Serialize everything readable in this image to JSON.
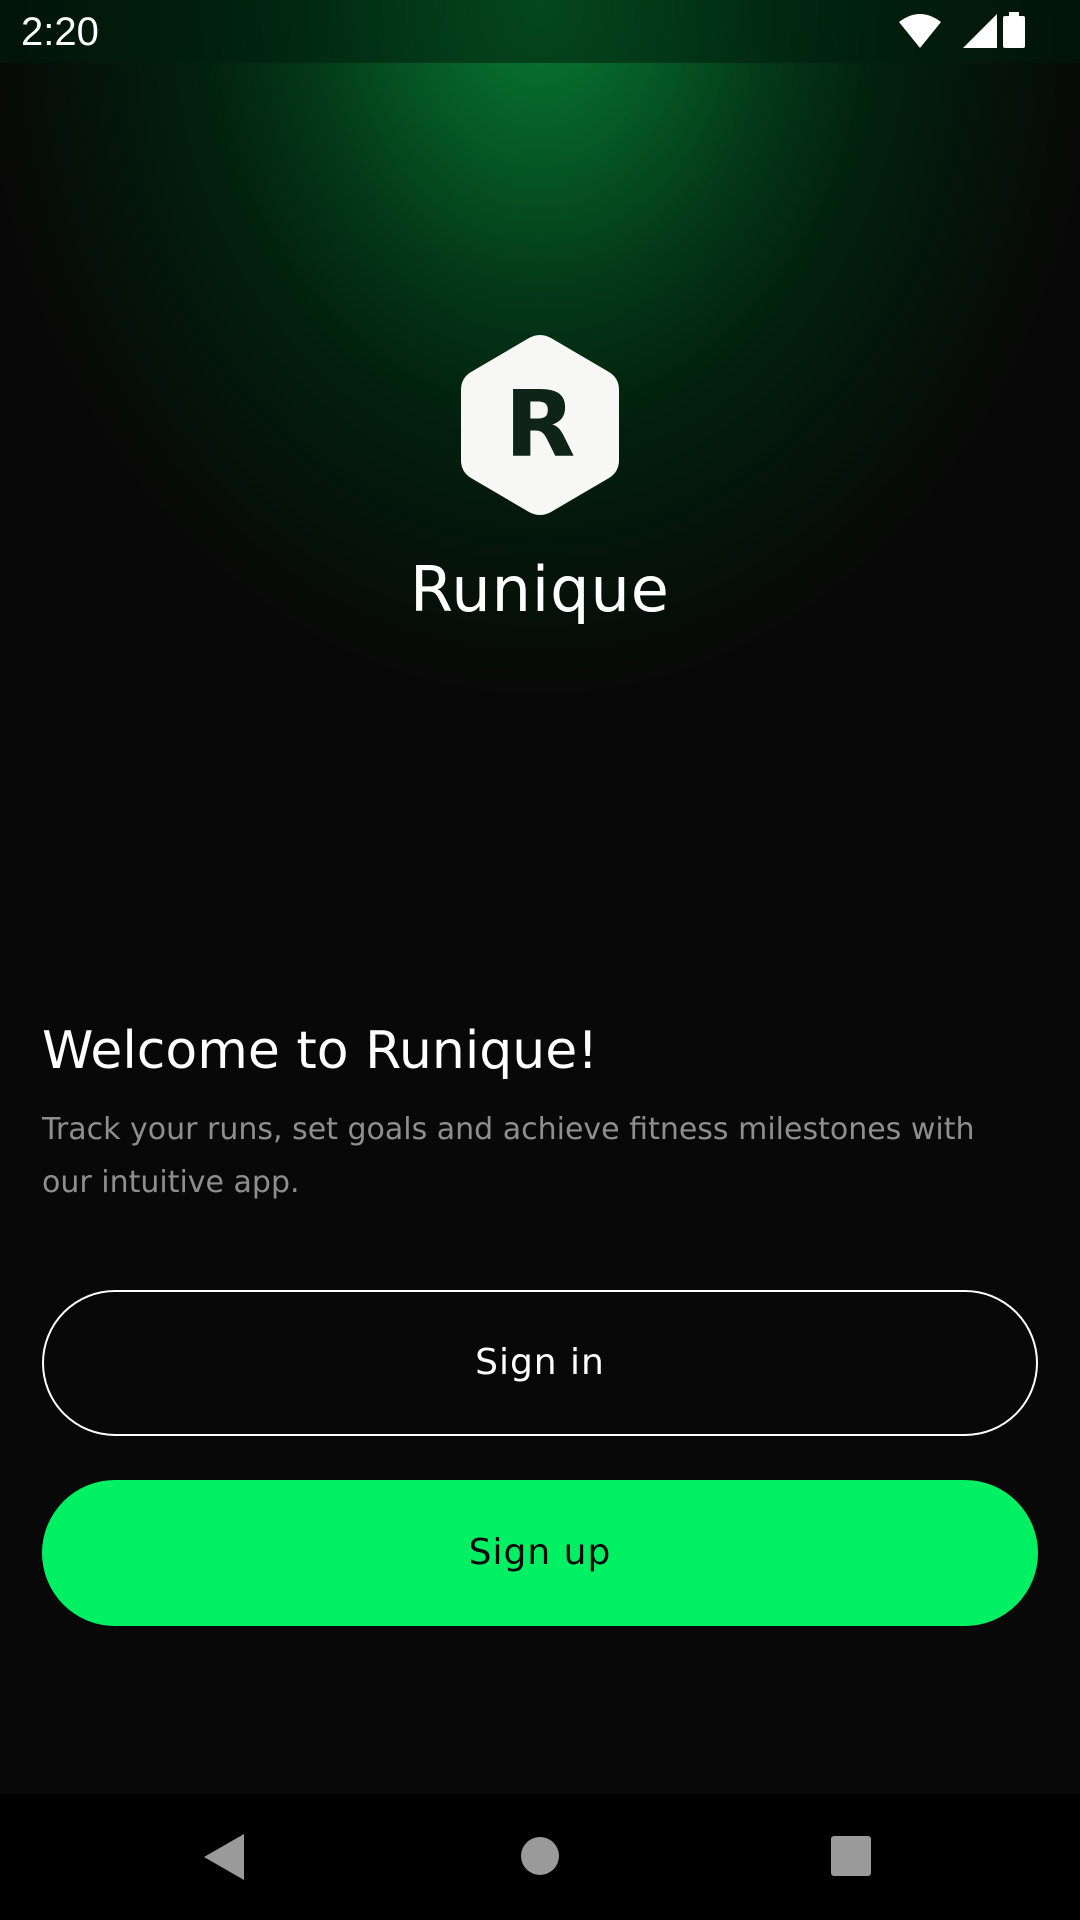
{
  "status_bar": {
    "time": "2:20",
    "icons": [
      "wifi-icon",
      "cellular-signal-icon",
      "battery-icon"
    ]
  },
  "logo": {
    "letter": "R",
    "icon": "hexagon-logo-icon"
  },
  "app_name": "Runique",
  "welcome": {
    "title": "Welcome to Runique!",
    "body": "Track your runs, set goals and achieve fitness milestones with our intuitive app."
  },
  "buttons": {
    "sign_in": "Sign in",
    "sign_up": "Sign up"
  },
  "nav_bar": {
    "icons": [
      "back-icon",
      "home-icon",
      "recents-icon"
    ]
  },
  "colors": {
    "accent": "#00f064",
    "background": "#080808",
    "glow": "#0a7a34",
    "secondary_text": "#8e8e8e"
  }
}
